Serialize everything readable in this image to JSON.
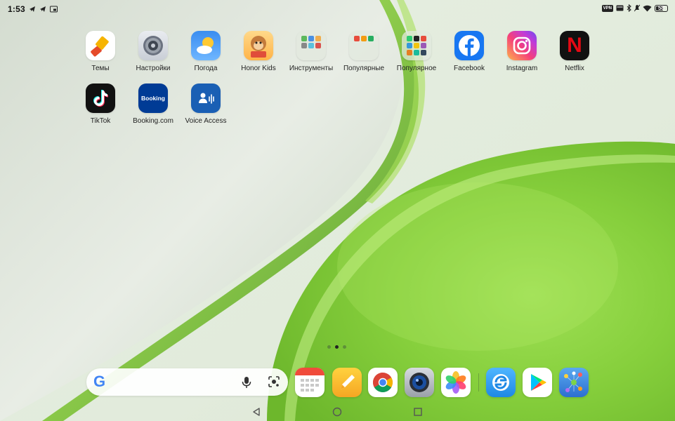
{
  "status_bar": {
    "time": "1:53",
    "left_icons": [
      "telegram-icon",
      "telegram-icon",
      "picture-in-picture-icon"
    ],
    "vpn_label": "VPN",
    "battery_level": "58",
    "right_icons": [
      "vpn-icon",
      "card-icon",
      "bluetooth-icon",
      "silent-icon",
      "wifi-icon",
      "battery-icon"
    ]
  },
  "apps": [
    {
      "label": "Темы",
      "icon": "themes-icon"
    },
    {
      "label": "Настройки",
      "icon": "settings-icon"
    },
    {
      "label": "Погода",
      "icon": "weather-icon"
    },
    {
      "label": "Honor Kids",
      "icon": "honor-kids-icon"
    },
    {
      "label": "Инструменты",
      "icon": "tools-folder-icon"
    },
    {
      "label": "Популярные",
      "icon": "popular-folder-icon"
    },
    {
      "label": "Популярное",
      "icon": "popular-folder-icon"
    },
    {
      "label": "Facebook",
      "icon": "facebook-icon"
    },
    {
      "label": "Instagram",
      "icon": "instagram-icon"
    },
    {
      "label": "Netflix",
      "icon": "netflix-icon"
    },
    {
      "label": "TikTok",
      "icon": "tiktok-icon"
    },
    {
      "label": "Booking.com",
      "icon": "booking-icon",
      "icon_text": "Booking"
    },
    {
      "label": "Voice Access",
      "icon": "voice-access-icon"
    }
  ],
  "netflix_letter": "N",
  "google_letter": "G",
  "page_indicator": {
    "pages": 3,
    "active": 2
  },
  "dock": [
    {
      "name": "calendar-icon"
    },
    {
      "name": "notes-icon"
    },
    {
      "name": "chrome-icon"
    },
    {
      "name": "camera-icon"
    },
    {
      "name": "gallery-icon"
    },
    {
      "name": "browser-icon"
    },
    {
      "name": "play-store-icon"
    },
    {
      "name": "app-gallery-folder-icon"
    }
  ],
  "colors": {
    "wallpaper_green": "#8fd24a",
    "facebook": "#1877f2",
    "netflix_red": "#e50914",
    "booking": "#003b95"
  }
}
